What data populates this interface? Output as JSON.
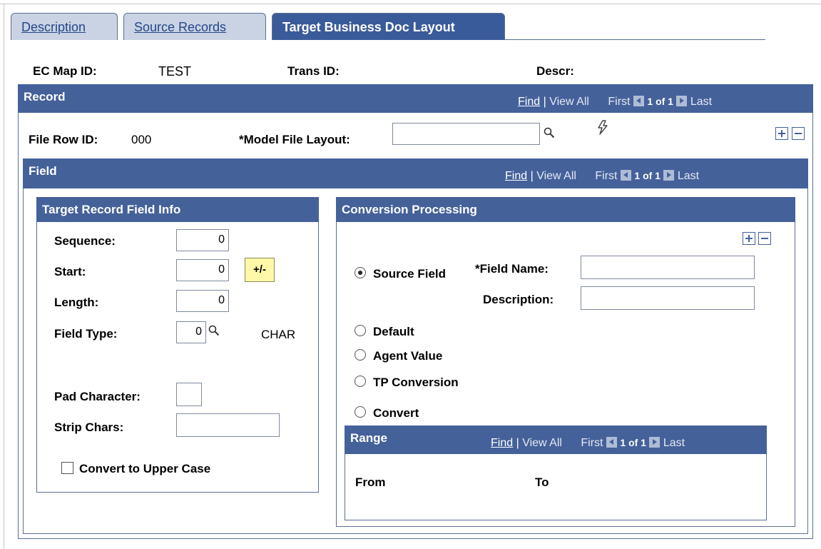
{
  "tabs": [
    {
      "label": "Description",
      "active": false
    },
    {
      "label": "Source Records",
      "active": false
    },
    {
      "label": "Target Business Doc Layout",
      "active": true
    }
  ],
  "header": {
    "map_id_label": "EC Map ID:",
    "map_id_value": "TEST",
    "trans_id_label": "Trans ID:",
    "trans_id_value": "",
    "descr_label": "Descr:",
    "descr_value": ""
  },
  "record": {
    "title": "Record",
    "find": "Find",
    "view_all": "View All",
    "first": "First",
    "count": "1 of 1",
    "last": "Last",
    "file_row_id_label": "File Row ID:",
    "file_row_id_value": "000",
    "model_file_layout_label": "*Model File Layout:",
    "model_file_layout_value": ""
  },
  "field": {
    "title": "Field",
    "find": "Find",
    "view_all": "View All",
    "first": "First",
    "count": "1 of 1",
    "last": "Last"
  },
  "target_info": {
    "title": "Target Record Field Info",
    "sequence_label": "Sequence:",
    "sequence_value": "0",
    "start_label": "Start:",
    "start_value": "0",
    "plusminus_label": "+/-",
    "length_label": "Length:",
    "length_value": "0",
    "field_type_label": "Field Type:",
    "field_type_value": "0",
    "field_type_desc": "CHAR",
    "pad_label": "Pad Character:",
    "pad_value": "",
    "strip_label": "Strip Chars:",
    "strip_value": "",
    "upper_label": "Convert to Upper Case",
    "upper_checked": false
  },
  "conversion": {
    "title": "Conversion Processing",
    "options": [
      "Source Field",
      "Default",
      "Agent Value",
      "TP Conversion",
      "Convert"
    ],
    "selected": "Source Field",
    "field_name_label": "*Field Name:",
    "field_name_value": "",
    "description_label": "Description:",
    "description_value": ""
  },
  "range": {
    "title": "Range",
    "find": "Find",
    "view_all": "View All",
    "first": "First",
    "count": "1 of 1",
    "last": "Last",
    "from_label": "From",
    "to_label": "To"
  },
  "colors": {
    "bar": "#44619a",
    "active_tab": "#3a5b9a",
    "inactive_tab": "#c9d3e3",
    "button_yellow": "#fff8a8"
  }
}
